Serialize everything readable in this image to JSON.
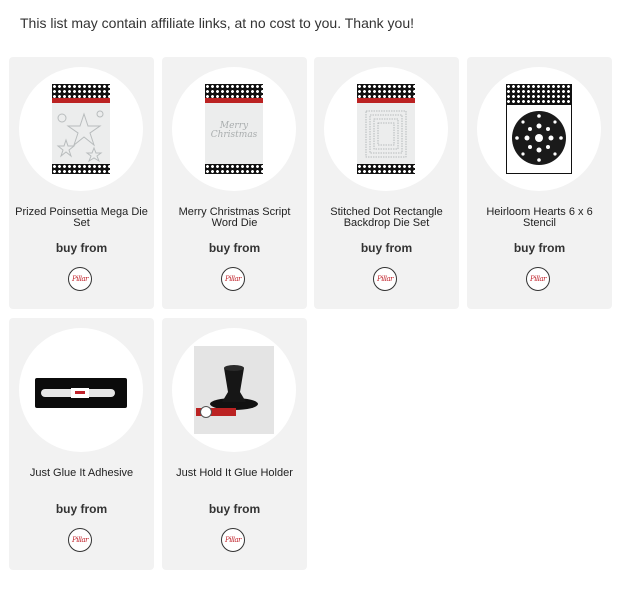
{
  "disclaimer": "This list may contain affiliate links, at no cost to you. Thank you!",
  "products": [
    {
      "name": "Prized Poinsettia Mega Die Set",
      "buy_label": "buy from",
      "store_logo": "Pillar logo",
      "image_icon": "poinsettia-die-package-icon"
    },
    {
      "name": "Merry Christmas Script Word Die",
      "buy_label": "buy from",
      "store_logo": "Pillar logo",
      "image_icon": "script-die-package-icon",
      "package_text": "Merry Christmas"
    },
    {
      "name": "Stitched Dot Rectangle Backdrop Die Set",
      "buy_label": "buy from",
      "store_logo": "Pillar logo",
      "image_icon": "rectangle-die-package-icon"
    },
    {
      "name": "Heirloom Hearts 6 x 6 Stencil",
      "buy_label": "buy from",
      "store_logo": "Pillar logo",
      "image_icon": "heart-stencil-package-icon"
    },
    {
      "name": "Just Glue It Adhesive",
      "buy_label": "buy from",
      "store_logo": "Pillar logo",
      "image_icon": "glue-pen-icon"
    },
    {
      "name": "Just Hold It Glue Holder",
      "buy_label": "buy from",
      "store_logo": "Pillar logo",
      "image_icon": "glue-holder-icon"
    }
  ],
  "colors": {
    "card_bg": "#f2f2f2",
    "accent_red": "#c0232b",
    "package_black": "#111111"
  }
}
